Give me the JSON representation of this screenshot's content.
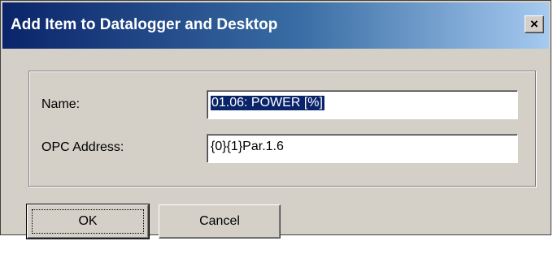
{
  "dialog": {
    "title": "Add Item to Datalogger and Desktop",
    "close_glyph": "×",
    "close_icon": "close-icon"
  },
  "form": {
    "name_label": "Name:",
    "name_value": "01.06: POWER [%]",
    "opc_label": "OPC Address:",
    "opc_value": "{0}{1}Par.1.6"
  },
  "buttons": {
    "ok": "OK",
    "cancel": "Cancel"
  },
  "colors": {
    "titlebar_start": "#0a246a",
    "titlebar_end": "#a6caf0",
    "face": "#d4d0c8",
    "selection": "#0a246a"
  }
}
